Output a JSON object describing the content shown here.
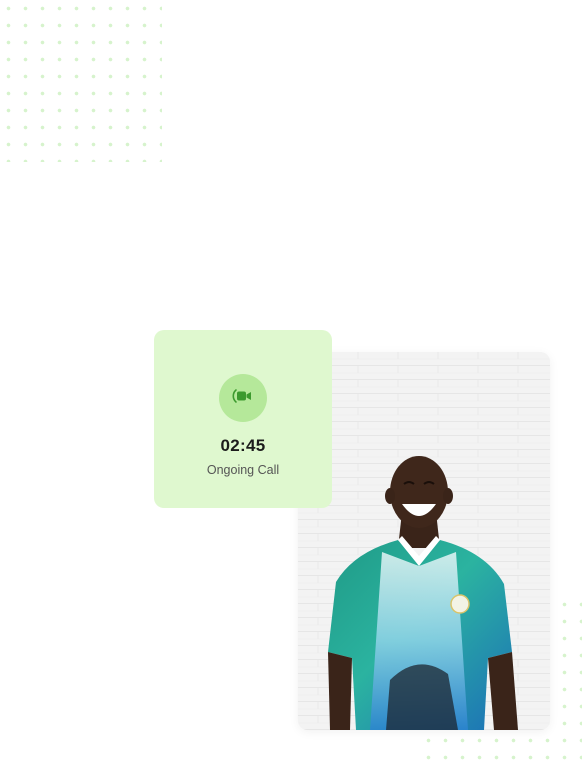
{
  "call": {
    "timer": "02:45",
    "status": "Ongoing Call",
    "icon": "video-camera-icon"
  },
  "photo": {
    "subject": "smiling-man-portrait"
  },
  "colors": {
    "card_bg": "#dff8cf",
    "icon_circle": "#b5e89a",
    "accent": "#3c9a2e",
    "dots": "#d6f3cc"
  }
}
